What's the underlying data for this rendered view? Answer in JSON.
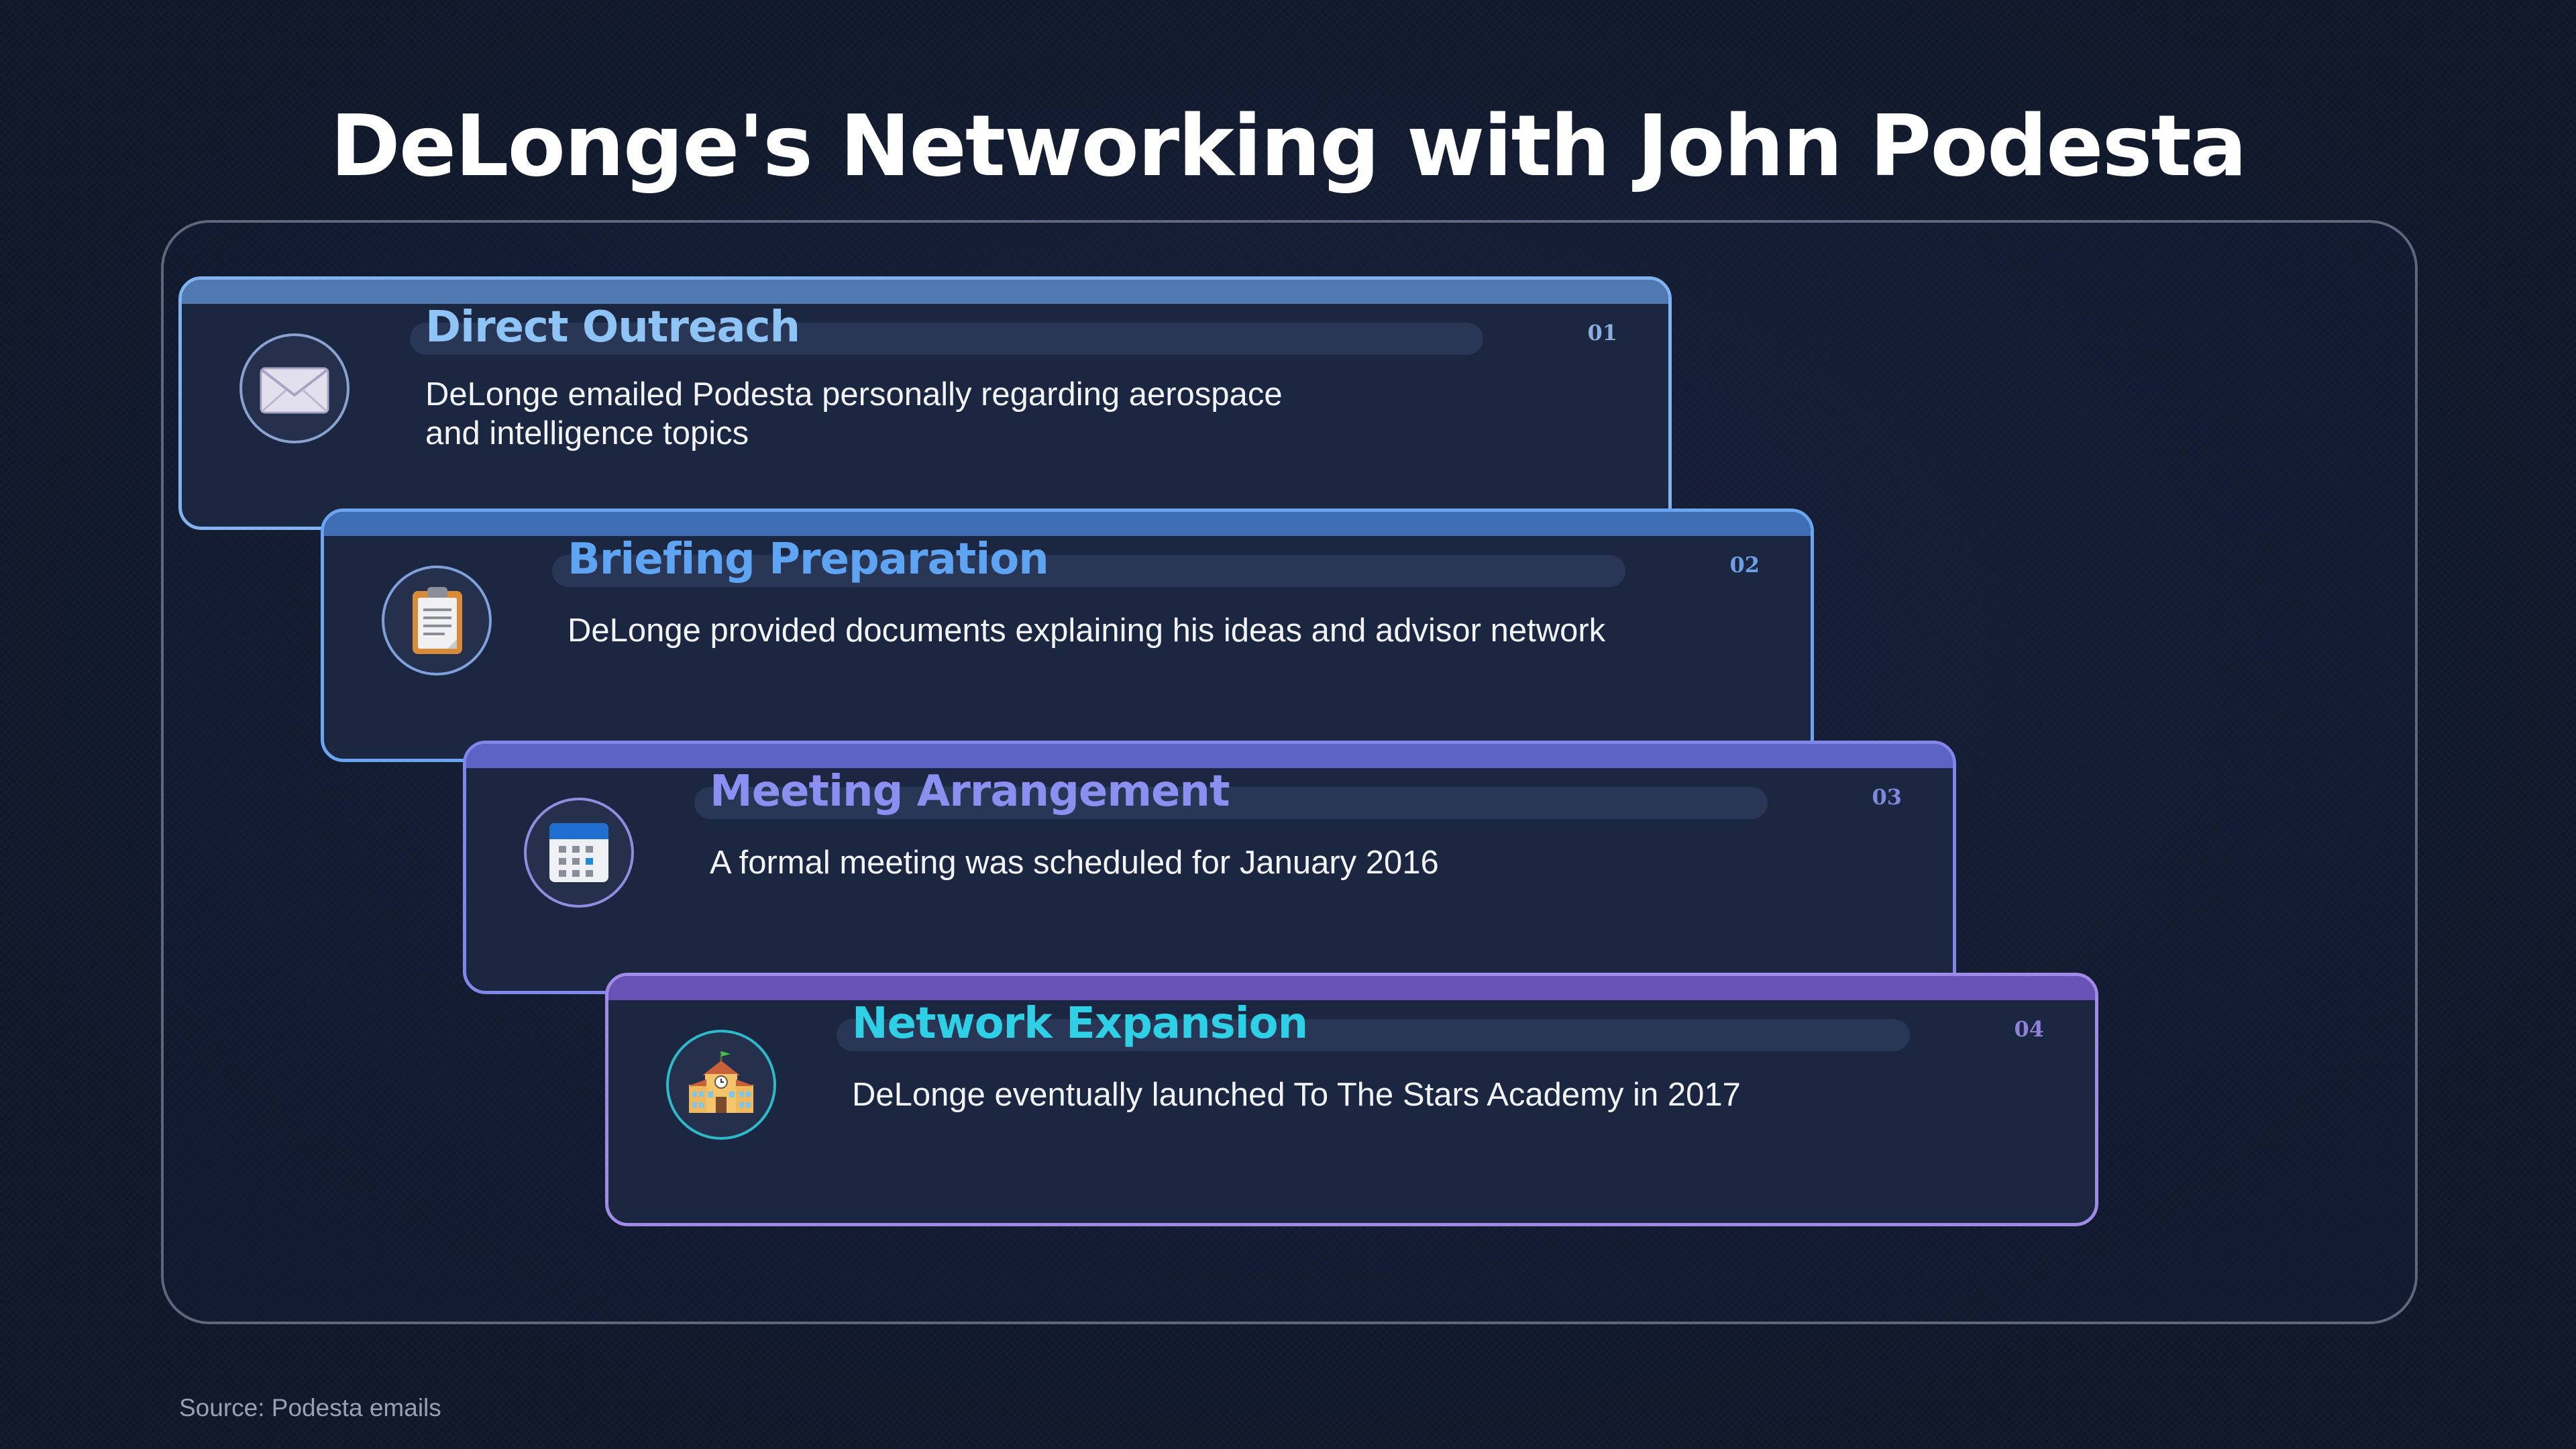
{
  "title": "DeLonge's Networking with John Podesta",
  "steps": [
    {
      "number": "01",
      "heading": "Direct Outreach",
      "description": "DeLonge emailed Podesta personally regarding aerospace and intelligence topics",
      "icon": "envelope-icon"
    },
    {
      "number": "02",
      "heading": "Briefing Preparation",
      "description": "DeLonge provided documents explaining his ideas and advisor network",
      "icon": "clipboard-icon"
    },
    {
      "number": "03",
      "heading": "Meeting Arrangement",
      "description": "A formal meeting was scheduled for January 2016",
      "icon": "calendar-icon"
    },
    {
      "number": "04",
      "heading": "Network Expansion",
      "description": "DeLonge eventually launched To The Stars Academy in 2017",
      "icon": "school-icon"
    }
  ],
  "source": "Source: Podesta emails",
  "colors": {
    "background": "#111a2c",
    "step1_heading": "#8ec3f5",
    "step2_heading": "#5ea4f2",
    "step3_heading": "#8c8ff0",
    "step4_heading": "#2fd0e6"
  }
}
